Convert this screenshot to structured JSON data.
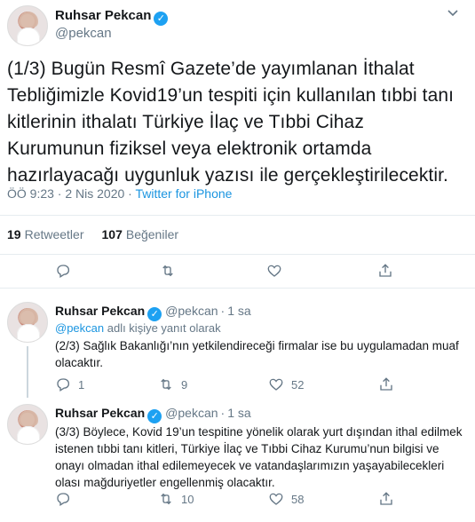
{
  "main": {
    "author_name": "Ruhsar Pekcan",
    "author_handle": "@pekcan",
    "text": "(1/3) Bugün Resmî Gazete’de yayımlanan İthalat Tebliğimizle Kovid19’un tespiti için kullanılan tıbbi tanı kitlerinin ithalatı Türkiye İlaç ve Tıbbi Cihaz Kurumunun fiziksel veya elektronik ortamda hazırlayacağı uygunluk yazısı ile gerçekleştirilecektir.",
    "time": "ÖÖ 9:23 · 2 Nis 2020 · ",
    "source": "Twitter for iPhone",
    "retweet_count": "19",
    "retweet_label": "Retweetler",
    "like_count": "107",
    "like_label": "Beğeniler"
  },
  "replies": [
    {
      "author_name": "Ruhsar Pekcan",
      "author_handle": "@pekcan",
      "separator": "·",
      "time": "1 sa",
      "reply_to_mention": "@pekcan",
      "reply_to_suffix": " adlı kişiye yanıt olarak",
      "text": "(2/3) Sağlık Bakanlığı’nın yetkilendireceği firmalar ise bu uygulamadan muaf olacaktır.",
      "reply_count": "1",
      "retweet_count": "9",
      "like_count": "52"
    },
    {
      "author_name": "Ruhsar Pekcan",
      "author_handle": "@pekcan",
      "separator": "·",
      "time": "1 sa",
      "text": "(3/3) Böylece, Kovid 19’un tespitine yönelik olarak yurt dışından ithal edilmek istenen tıbbi tanı kitleri, Türkiye İlaç ve Tıbbi Cihaz Kurumu’nun bilgisi ve onayı olmadan ithal edilemeyecek ve vatandaşlarımızın yaşayabilecekleri olası mağduriyetler engellenmiş olacaktır.",
      "reply_count": "",
      "retweet_count": "10",
      "like_count": "58"
    }
  ],
  "icons": {
    "verified": "verified-badge-icon",
    "chevron": "chevron-down-icon",
    "reply": "reply-icon",
    "retweet": "retweet-icon",
    "like": "heart-icon",
    "share": "share-icon"
  },
  "colors": {
    "link": "#1b95e0",
    "verified": "#1da1f2",
    "secondary_text": "#657786",
    "divider": "#e6ecf0"
  }
}
